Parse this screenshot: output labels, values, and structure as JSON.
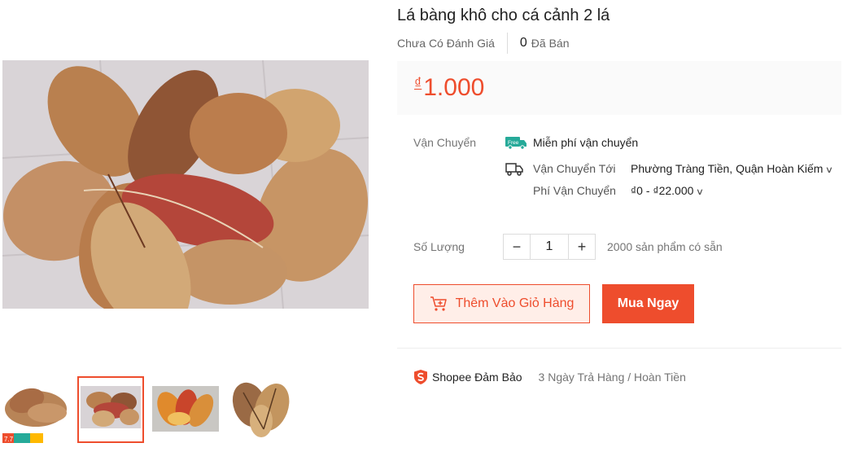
{
  "product": {
    "title": "Lá bàng khô cho cá cảnh 2 lá",
    "rating_text": "Chưa Có Đánh Giá",
    "sold_count": "0",
    "sold_label": "Đã Bán",
    "currency_symbol": "₫",
    "price": "1.000"
  },
  "shipping": {
    "section_label": "Vận Chuyển",
    "free_badge": "Free",
    "free_label": "Miễn phí vận chuyển",
    "to_label": "Vận Chuyển Tới",
    "to_value": "Phường Tràng Tiền, Quận Hoàn Kiếm",
    "fee_label": "Phí Vận Chuyển",
    "fee_value": "₫0 - ₫22.000"
  },
  "quantity": {
    "label": "Số Lượng",
    "decrease": "−",
    "value": "1",
    "increase": "+",
    "stock_text": "2000 sản phẩm có sẵn"
  },
  "actions": {
    "add_to_cart": "Thêm Vào Giỏ Hàng",
    "buy_now": "Mua Ngay"
  },
  "guarantee": {
    "brand": "Shopee Đảm Bảo",
    "policy": "3 Ngày Trả Hàng / Hoàn Tiền"
  },
  "gallery": {
    "main_image": "dried-almond-leaves-photo",
    "thumbnails": [
      {
        "image": "leaves-pile-thumbnail",
        "badge": "7.7",
        "active": false
      },
      {
        "image": "leaves-closeup-thumbnail",
        "active": true
      },
      {
        "image": "orange-leaves-thumbnail",
        "active": false
      },
      {
        "image": "brown-leaves-thumbnail",
        "active": false
      }
    ]
  },
  "colors": {
    "accent": "#ee4d2d",
    "free_badge": "#26aa99"
  }
}
